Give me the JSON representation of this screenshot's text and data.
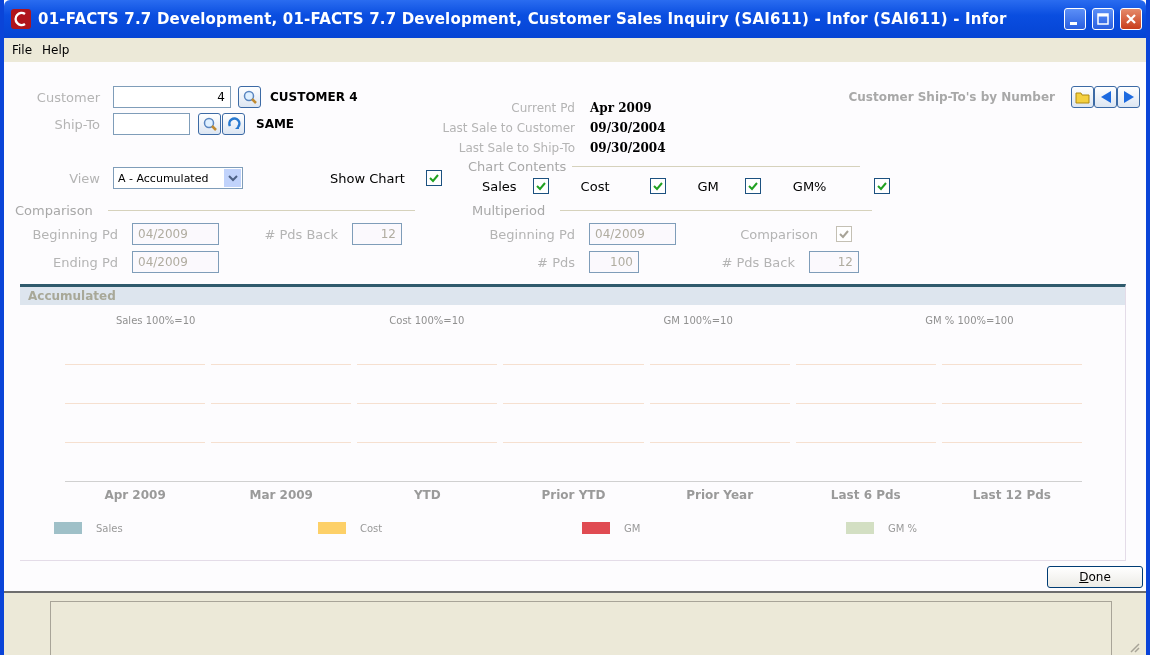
{
  "window": {
    "title": "01-FACTS 7.7 Development, 01-FACTS 7.7 Development, Customer Sales Inquiry (SAI611) - Infor (SAI611) - Infor"
  },
  "menu": [
    "File",
    "Help"
  ],
  "customer": {
    "label": "Customer",
    "value": "4",
    "name": "CUSTOMER 4"
  },
  "ship_to": {
    "label": "Ship-To",
    "name": "SAME"
  },
  "info": [
    {
      "label": "Current Pd",
      "value": "Apr 2009"
    },
    {
      "label": "Last Sale to Customer",
      "value": "09/30/2004"
    },
    {
      "label": "Last Sale to Ship-To",
      "value": "09/30/2004"
    }
  ],
  "lookup": {
    "title": "Customer Ship-To's by Number"
  },
  "view": {
    "label": "View",
    "value": "A - Accumulated"
  },
  "show_chart": {
    "label": "Show Chart",
    "checked": true
  },
  "chart_contents": {
    "title": "Chart Contents",
    "items": [
      {
        "label": "Sales",
        "checked": true
      },
      {
        "label": "Cost",
        "checked": true
      },
      {
        "label": "GM",
        "checked": true
      },
      {
        "label": "GM%",
        "checked": true
      }
    ]
  },
  "comparison": {
    "title": "Comparison",
    "beginning_pd": {
      "label": "Beginning Pd",
      "value": "04/2009",
      "disabled": true
    },
    "ending_pd": {
      "label": "Ending Pd",
      "value": "04/2009",
      "disabled": true
    },
    "pds_back": {
      "label": "# Pds Back",
      "value": "12",
      "disabled": true
    }
  },
  "multiperiod": {
    "title": "Multiperiod",
    "beginning_pd": {
      "label": "Beginning Pd",
      "value": "04/2009",
      "disabled": true
    },
    "pds": {
      "label": "# Pds",
      "value": "100",
      "disabled": true
    },
    "comparison": {
      "label": "Comparison",
      "checked": true,
      "disabled": true
    },
    "pds_back": {
      "label": "# Pds Back",
      "value": "12",
      "disabled": true
    }
  },
  "chart_panel": {
    "title": "Accumulated",
    "subtitles": [
      "Sales 100%=10",
      "Cost 100%=10",
      "GM 100%=10",
      "GM % 100%=100"
    ],
    "categories": [
      "Apr 2009",
      "Mar 2009",
      "YTD",
      "Prior YTD",
      "Prior Year",
      "Last 6 Pds",
      "Last 12 Pds"
    ],
    "legend": [
      {
        "label": "Sales",
        "color": "#9fc0c8"
      },
      {
        "label": "Cost",
        "color": "#fdd068"
      },
      {
        "label": "GM",
        "color": "#e04b52"
      },
      {
        "label": "GM %",
        "color": "#d3dfc3"
      }
    ]
  },
  "buttons": [
    {
      "label": "Done"
    }
  ]
}
